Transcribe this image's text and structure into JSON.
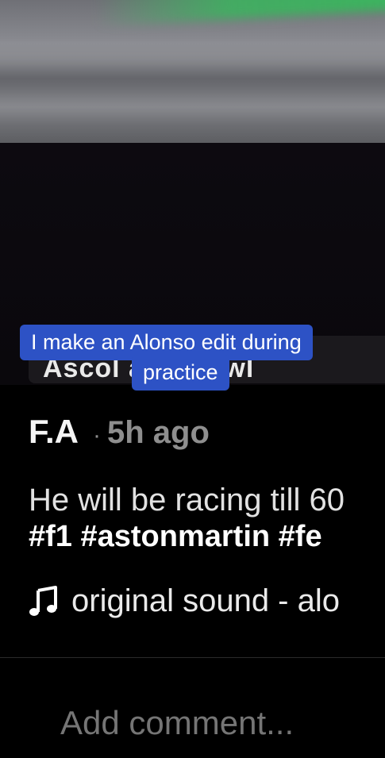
{
  "caption": {
    "line1": "I make an Alonso edit during",
    "line2": "practice"
  },
  "ghost_text": "Ascol                ail Knowl",
  "post": {
    "author": "F.A",
    "separator": "·",
    "time": "5h ago",
    "description": "He will be racing till 60",
    "hashtags": "#f1 #astonmartin #fe"
  },
  "sound": {
    "icon": "music-note-icon",
    "label": "original sound - alo"
  },
  "comment": {
    "placeholder": "Add comment..."
  }
}
